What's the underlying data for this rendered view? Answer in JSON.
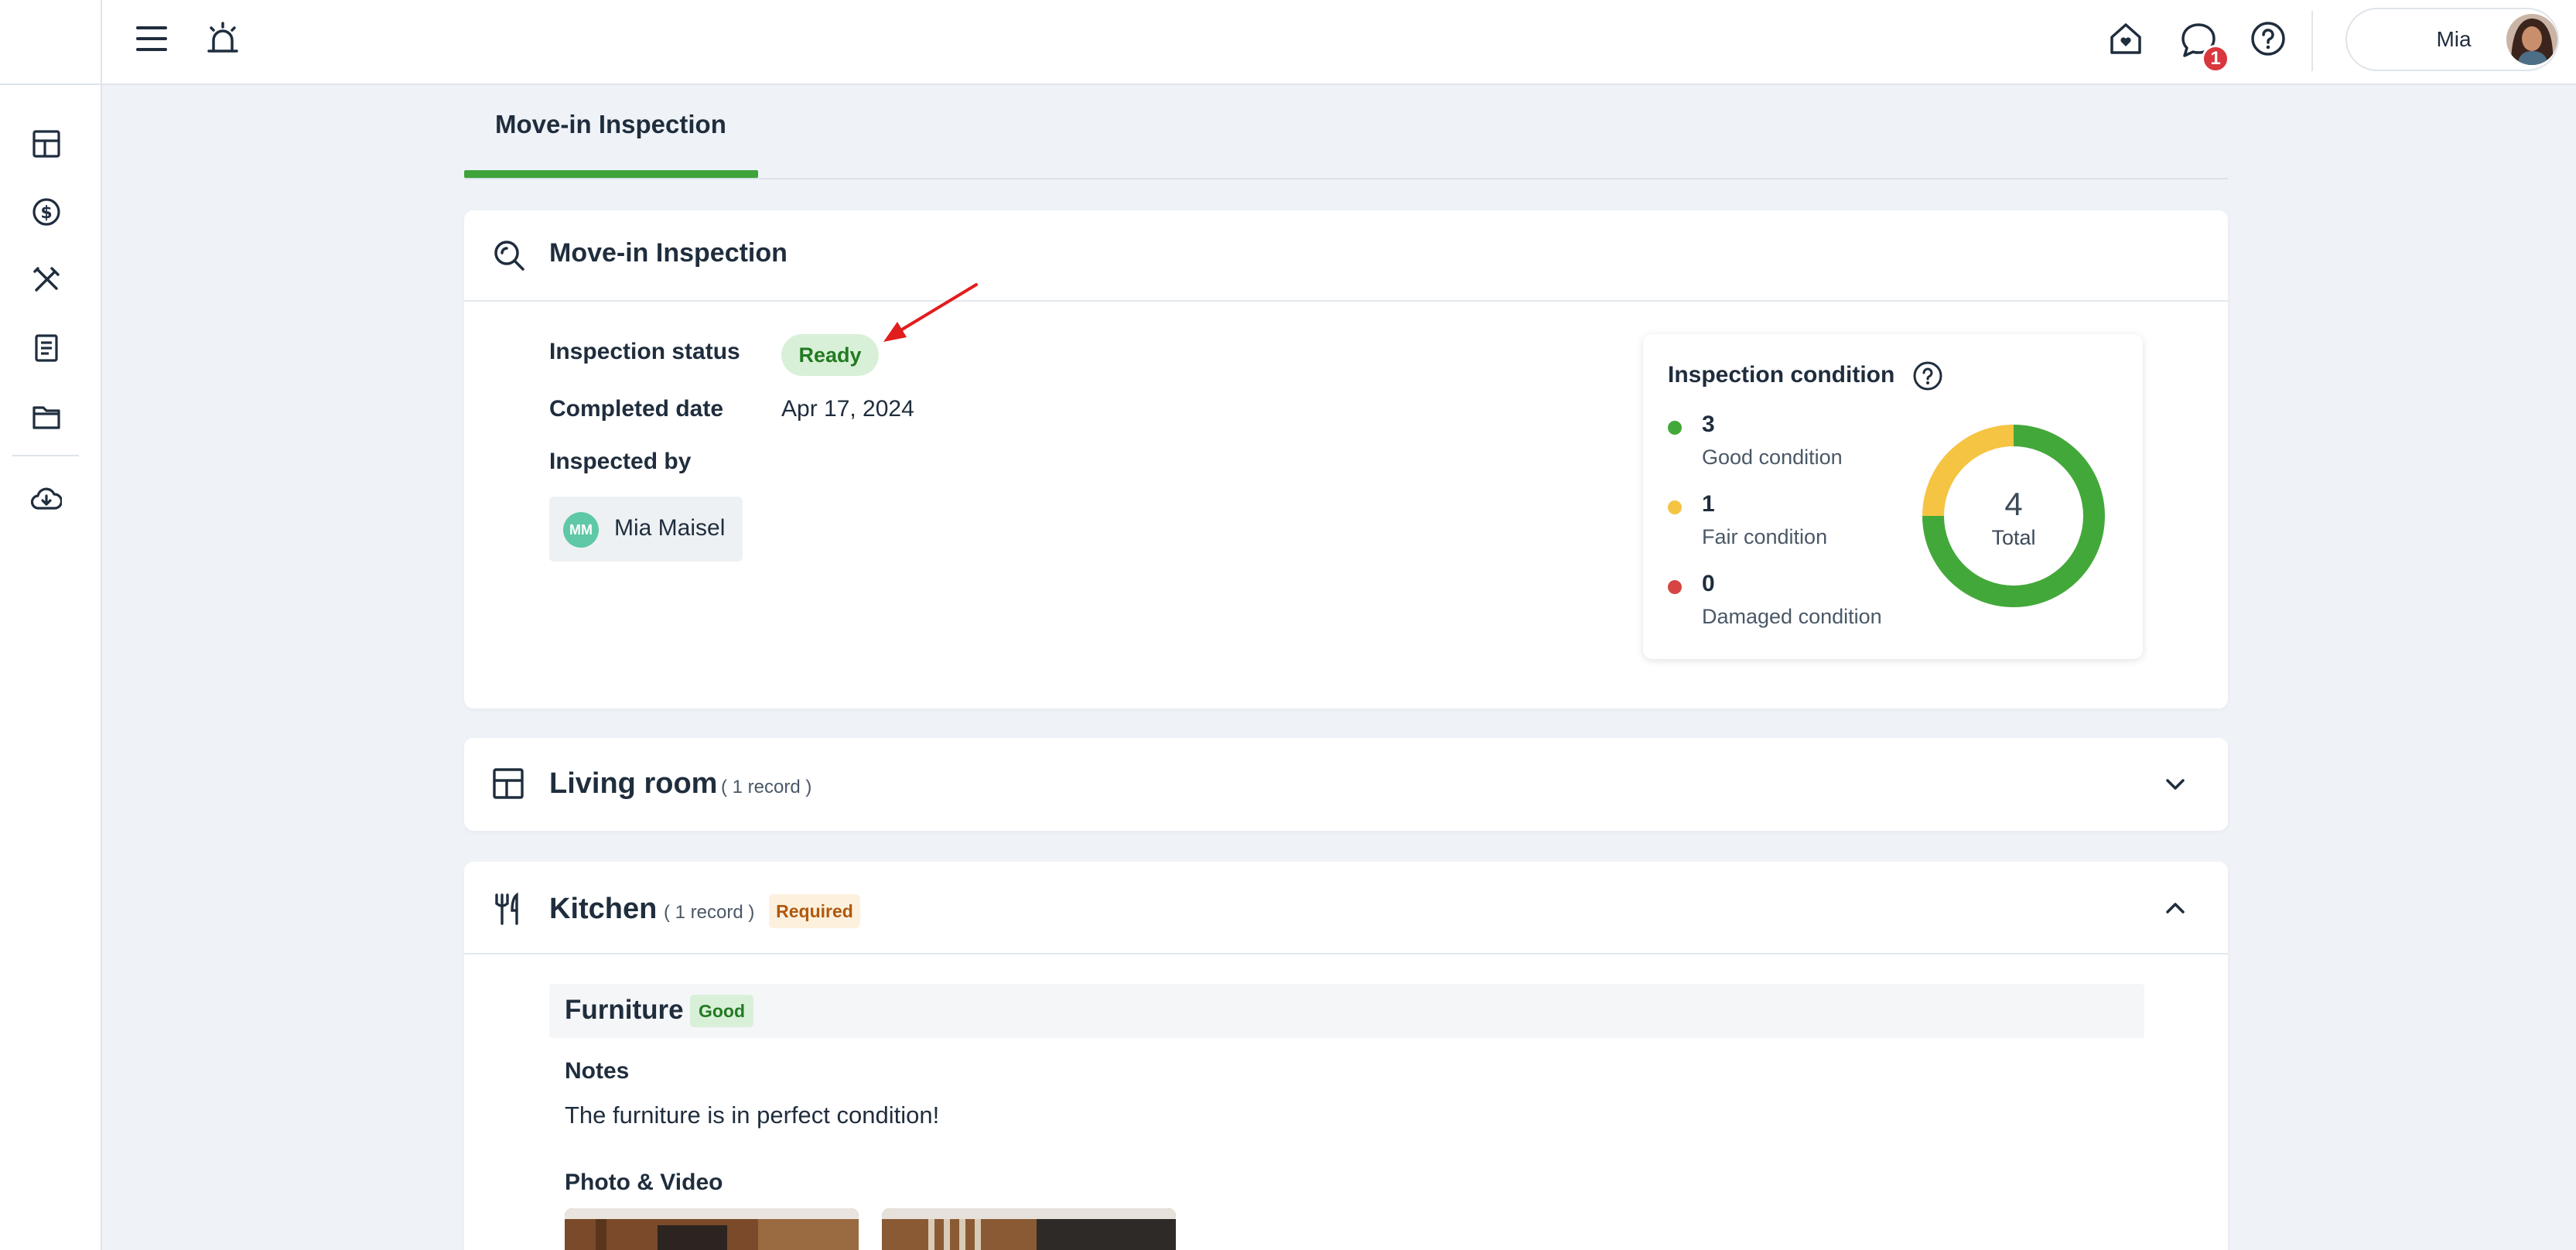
{
  "topbar": {
    "menu_icon": "hamburger-menu-icon",
    "brand_icon": "alarm-bell-icon",
    "home_icon": "home-heart-icon",
    "messages_icon": "chat-bubble-icon",
    "messages_badge": "1",
    "help_icon": "question-circle-icon",
    "user_name": "Mia"
  },
  "sidebar": {
    "items": [
      {
        "icon": "dashboard-grid-icon"
      },
      {
        "icon": "dollar-circle-icon"
      },
      {
        "icon": "tools-icon"
      },
      {
        "icon": "document-icon"
      },
      {
        "icon": "folder-icon"
      },
      {
        "icon": "cloud-download-icon"
      }
    ]
  },
  "tabs": [
    {
      "label": "Move-in Inspection",
      "active": true
    }
  ],
  "inspection": {
    "title": "Move-in Inspection",
    "status_label": "Inspection status",
    "status_value": "Ready",
    "completed_label": "Completed date",
    "completed_value": "Apr 17, 2024",
    "inspected_by_label": "Inspected by",
    "inspector_initials": "MM",
    "inspector_name": "Mia Maisel"
  },
  "condition": {
    "title": "Inspection condition",
    "total_value": "4",
    "total_label": "Total",
    "legend": [
      {
        "count": "3",
        "label": "Good condition",
        "color": "#43a83a"
      },
      {
        "count": "1",
        "label": "Fair condition",
        "color": "#f5c443"
      },
      {
        "count": "0",
        "label": "Damaged condition",
        "color": "#d64541"
      }
    ]
  },
  "chart_data": {
    "type": "pie",
    "categories": [
      "Good condition",
      "Fair condition",
      "Damaged condition"
    ],
    "values": [
      3,
      1,
      0
    ],
    "colors": [
      "#43a83a",
      "#f5c443",
      "#d64541"
    ],
    "title": "Inspection condition"
  },
  "rooms": [
    {
      "name": "Living room",
      "count": "( 1 record )",
      "icon": "room-grid-icon",
      "expanded": false
    },
    {
      "name": "Kitchen",
      "count": "( 1 record )",
      "icon": "fork-knife-icon",
      "required": "Required",
      "expanded": true
    }
  ],
  "kitchen_item": {
    "name": "Furniture",
    "condition": "Good",
    "notes_label": "Notes",
    "notes_value": "The furniture is in perfect condition!",
    "media_label": "Photo & Video"
  },
  "colors": {
    "accent_green": "#3fa33b",
    "badge_red": "#d9363e",
    "page_bg": "#eff3f8"
  }
}
